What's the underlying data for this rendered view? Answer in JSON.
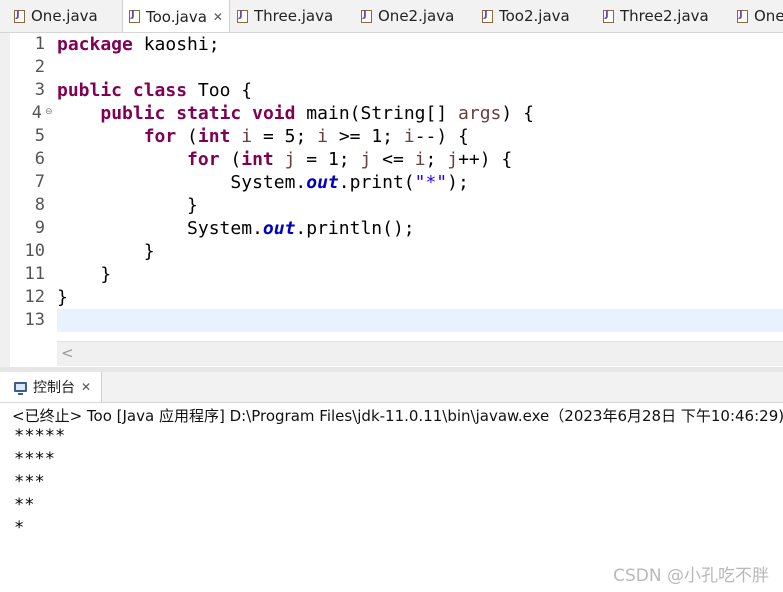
{
  "tabs": [
    {
      "label": "One.java"
    },
    {
      "label": "Too.java",
      "active": true,
      "close": "✕"
    },
    {
      "label": "Three.java"
    },
    {
      "label": "One2.java"
    },
    {
      "label": "Too2.java"
    },
    {
      "label": "Three2.java"
    },
    {
      "label": "One"
    }
  ],
  "editor": {
    "line_numbers": [
      "1",
      "2",
      "3",
      "4",
      "5",
      "6",
      "7",
      "8",
      "9",
      "10",
      "11",
      "12",
      "13"
    ],
    "fold_marker": "⊖",
    "current_line": 13,
    "code": {
      "l1": {
        "kw": "package",
        "rest": " kaoshi;"
      },
      "l3": {
        "kw1": "public",
        "kw2": "class",
        "rest": " Too {"
      },
      "l4": {
        "indent": "    ",
        "kw1": "public",
        "kw2": "static",
        "kw3": "void",
        "mid": " main(String[] ",
        "var": "args",
        "end": ") {"
      },
      "l5": {
        "indent": "        ",
        "kw1": "for",
        "a": " (",
        "kw2": "int",
        "v1": "i",
        "b": " = 5; ",
        "v2": "i",
        "c": " >= 1; ",
        "v3": "i",
        "d": "--) {"
      },
      "l6": {
        "indent": "            ",
        "kw1": "for",
        "a": " (",
        "kw2": "int",
        "v1": "j",
        "b": " = 1; ",
        "v2": "j",
        "c": " <= ",
        "v3": "i",
        "d": "; ",
        "v4": "j",
        "e": "++) {"
      },
      "l7": {
        "indent": "                ",
        "a": "System.",
        "fld": "out",
        "b": ".print(",
        "str": "\"*\"",
        "c": ");"
      },
      "l8": {
        "text": "            }"
      },
      "l9": {
        "indent": "            ",
        "a": "System.",
        "fld": "out",
        "b": ".println();"
      },
      "l10": {
        "text": "        }"
      },
      "l11": {
        "text": "    }"
      },
      "l12": {
        "text": "}"
      }
    },
    "scroll_left_arrow": "<"
  },
  "console": {
    "tab_label": "控制台",
    "tab_close": "✕",
    "status": "<已终止> Too [Java 应用程序] D:\\Program Files\\jdk-11.0.11\\bin\\javaw.exe（2023年6月28日 下午10:46:29)",
    "output": [
      "*****",
      "****",
      "***",
      "**",
      "*"
    ]
  },
  "watermark": "CSDN @小孔吃不胖",
  "colors": {
    "keyword": "#7f0055",
    "field": "#0000c0",
    "string": "#2a00ff",
    "local_var": "#6a3e3e",
    "current_line": "#e8f2fe"
  }
}
